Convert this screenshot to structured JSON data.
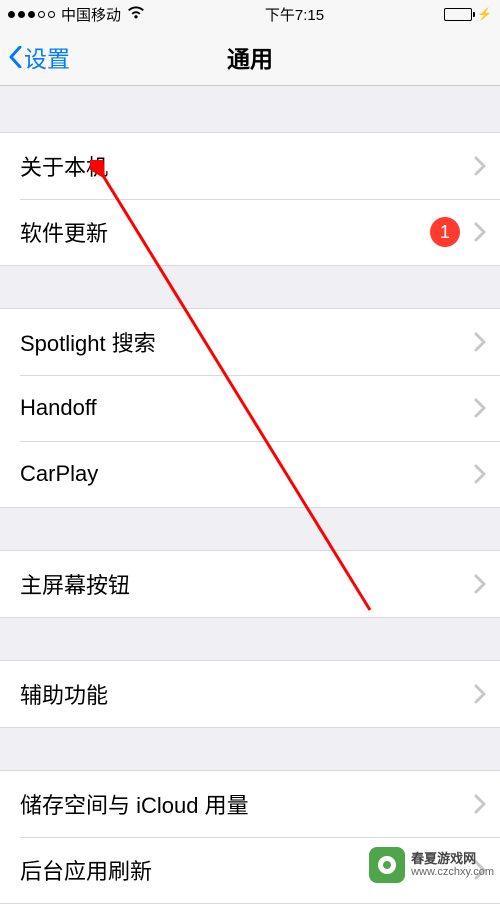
{
  "status": {
    "carrier": "中国移动",
    "time": "下午7:15"
  },
  "nav": {
    "back_label": "设置",
    "title": "通用"
  },
  "groups": [
    {
      "rows": [
        {
          "label": "关于本机",
          "badge": null
        },
        {
          "label": "软件更新",
          "badge": "1"
        }
      ]
    },
    {
      "rows": [
        {
          "label": "Spotlight 搜索",
          "badge": null
        },
        {
          "label": "Handoff",
          "badge": null
        },
        {
          "label": "CarPlay",
          "badge": null
        }
      ]
    },
    {
      "rows": [
        {
          "label": "主屏幕按钮",
          "badge": null
        }
      ]
    },
    {
      "rows": [
        {
          "label": "辅助功能",
          "badge": null
        }
      ]
    },
    {
      "rows": [
        {
          "label": "储存空间与 iCloud 用量",
          "badge": null
        },
        {
          "label": "后台应用刷新",
          "badge": null
        }
      ]
    }
  ],
  "watermark": {
    "line1": "春夏游戏网",
    "line2": "www.czchxy.com"
  },
  "colors": {
    "tint": "#007aff",
    "badge": "#ff3b30",
    "arrow": "#ff0000"
  }
}
